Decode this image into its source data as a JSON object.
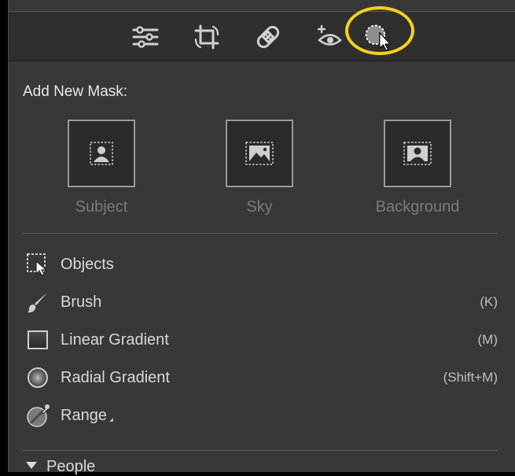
{
  "toolbar": {
    "tools": [
      {
        "icon": "edit-sliders-icon"
      },
      {
        "icon": "crop-icon"
      },
      {
        "icon": "healing-bandage-icon"
      },
      {
        "icon": "red-eye-icon"
      },
      {
        "icon": "masking-icon",
        "highlighted": true
      }
    ],
    "highlight_color": "#f7d11a"
  },
  "add_mask": {
    "title": "Add New Mask:",
    "tiles": [
      {
        "label": "Subject",
        "icon": "subject-icon"
      },
      {
        "label": "Sky",
        "icon": "sky-icon"
      },
      {
        "label": "Background",
        "icon": "background-icon"
      }
    ]
  },
  "mask_tools": [
    {
      "label": "Objects",
      "shortcut": "",
      "icon": "objects-icon"
    },
    {
      "label": "Brush",
      "shortcut": "(K)",
      "icon": "brush-icon"
    },
    {
      "label": "Linear Gradient",
      "shortcut": "(M)",
      "icon": "linear-gradient-icon"
    },
    {
      "label": "Radial Gradient",
      "shortcut": "(Shift+M)",
      "icon": "radial-gradient-icon"
    },
    {
      "label": "Range",
      "shortcut": "",
      "icon": "range-icon",
      "has_submenu": true
    }
  ],
  "people_section": {
    "label": "People"
  }
}
